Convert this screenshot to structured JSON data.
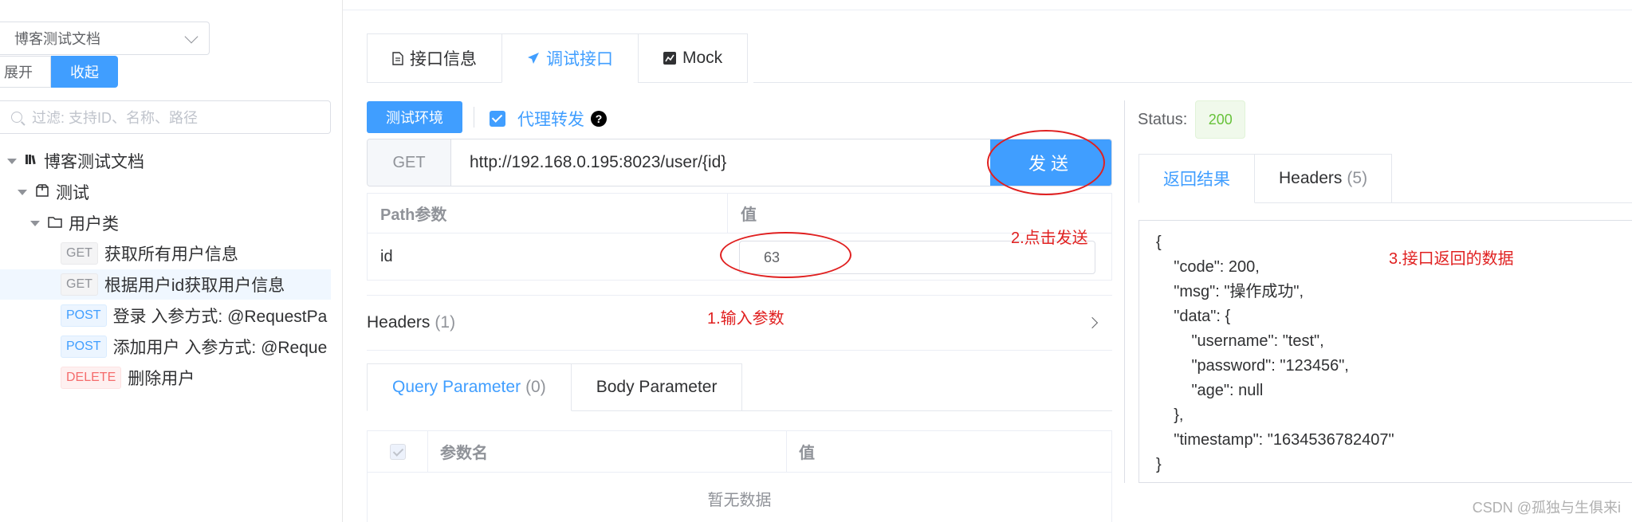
{
  "sidebar": {
    "project": "博客测试文档",
    "expand_label": "展开",
    "collapse_label": "收起",
    "filter_placeholder": "过滤: 支持ID、名称、路径",
    "tree": {
      "root": "博客测试文档",
      "group": "测试",
      "folder": "用户类",
      "items": [
        {
          "method": "GET",
          "name": "获取所有用户信息"
        },
        {
          "method": "GET",
          "name": "根据用户id获取用户信息"
        },
        {
          "method": "POST",
          "name": "登录 入参方式: @RequestPa"
        },
        {
          "method": "POST",
          "name": "添加用户 入参方式: @Reque"
        },
        {
          "method": "DELETE",
          "name": "删除用户"
        }
      ]
    }
  },
  "main": {
    "tabs": [
      {
        "icon": "document-icon",
        "label": "接口信息"
      },
      {
        "icon": "send-icon",
        "label": "调试接口"
      },
      {
        "icon": "chart-icon",
        "label": "Mock"
      }
    ],
    "env_label": "测试环境",
    "proxy_label": "代理转发",
    "help_glyph": "?",
    "url_method": "GET",
    "url": "http://192.168.0.195:8023/user/{id}",
    "send_label": "发送",
    "path_table": {
      "col_name": "Path参数",
      "col_value": "值",
      "row_name": "id",
      "row_value": "63"
    },
    "headers_label": "Headers",
    "headers_count": "(1)",
    "param_tabs": [
      {
        "label": "Query Parameter",
        "count": "(0)"
      },
      {
        "label": "Body Parameter",
        "count": ""
      }
    ],
    "query_table": {
      "col_name": "参数名",
      "col_value": "值",
      "empty": "暂无数据"
    }
  },
  "response": {
    "status_label": "Status:",
    "status_code": "200",
    "tabs": [
      {
        "label": "返回结果",
        "count": ""
      },
      {
        "label": "Headers",
        "count": "(5)"
      }
    ],
    "json_lines": [
      "{",
      "    \"code\": 200,",
      "    \"msg\": \"操作成功\",",
      "    \"data\": {",
      "        \"username\": \"test\",",
      "        \"password\": \"123456\",",
      "        \"age\": null",
      "    },",
      "    \"timestamp\": \"1634536782407\"",
      "}"
    ]
  },
  "annotations": {
    "step1": "1.输入参数",
    "step2": "2.点击发送",
    "step3": "3.接口返回的数据",
    "color": "#e02020"
  },
  "watermark": "CSDN @孤独与生俱来i",
  "colors": {
    "primary": "#409eff",
    "success": "#67c23a",
    "danger": "#f56c6c"
  }
}
